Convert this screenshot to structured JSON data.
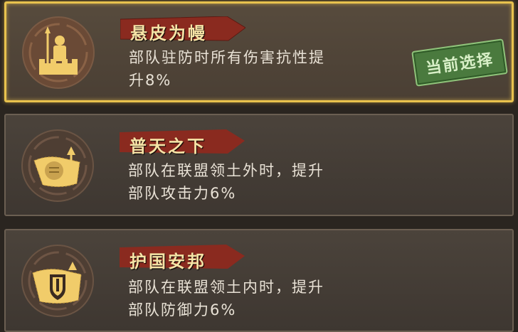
{
  "policies": [
    {
      "title": "悬皮为幔",
      "desc_line1": "部队驻防时所有伤害抗性提",
      "desc_line2": "升8%",
      "icon": "fortress-knight-icon",
      "selected": true,
      "badge": "当前选择"
    },
    {
      "title": "普天之下",
      "desc_line1": "部队在联盟领土外时，提升",
      "desc_line2": "部队攻击力6%",
      "icon": "fist-attack-icon",
      "selected": false
    },
    {
      "title": "护国安邦",
      "desc_line1": "部队在联盟领土内时，提升",
      "desc_line2": "部队防御力6%",
      "icon": "shield-defense-icon",
      "selected": false
    }
  ],
  "colors": {
    "selected_border": "#e8c24e",
    "title_ribbon": "#8a2a1f",
    "stamp_green": "#4a7a3e"
  }
}
